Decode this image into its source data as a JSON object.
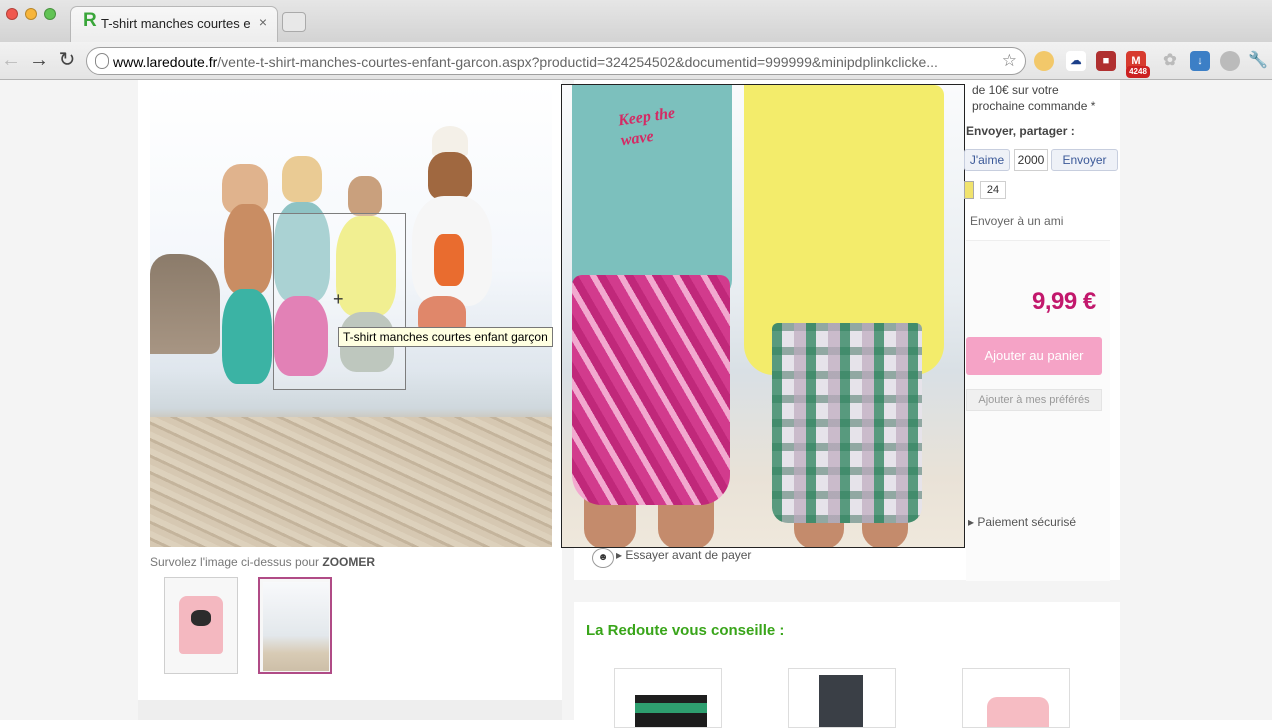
{
  "browser": {
    "tab_title": "T-shirt manches courtes enfant garçon",
    "tab_favicon": "R",
    "tab_close": "×",
    "url_host": "www.laredoute.fr",
    "url_path": "/vente-t-shirt-manches-courtes-enfant-garcon.aspx?productid=324254502&documentid=999999&minipdplinkclicke...",
    "extensions": [
      "cookie-icon",
      "cloud-icon",
      "app-icon",
      "gmail-icon",
      "puzzle-icon",
      "download-icon",
      "globe-icon",
      "wrench-icon"
    ],
    "gmail_badge": "4248"
  },
  "product": {
    "image_tooltip": "T-shirt manches courtes enfant garçon",
    "hover_hint_prefix": "Survolez l'image ci-dessus pour ",
    "hover_hint_bold": "ZOOMER",
    "zoom_print_text": "Keep the wave",
    "thumb_count": 2,
    "selected_thumb": 2
  },
  "sidebar": {
    "promo_text": "de 10€ sur votre prochaine commande *",
    "share_title": "Envoyer, partager :",
    "like_label": "J'aime",
    "like_count": "2000",
    "send_label": "Envoyer",
    "gplus_count": "24",
    "send_friend": "Envoyer à un ami",
    "price": "9,99 €",
    "add_to_cart": "Ajouter au panier",
    "add_to_favorites": "Ajouter à mes préférés",
    "secure_payment": "Paiement sécurisé",
    "try_before_pay": "Essayer avant de payer"
  },
  "recommendations": {
    "title": "La Redoute vous conseille :"
  },
  "colors": {
    "brand_green": "#39a51a",
    "price_pink": "#c2186c",
    "cart_button": "#f5a3c6"
  }
}
